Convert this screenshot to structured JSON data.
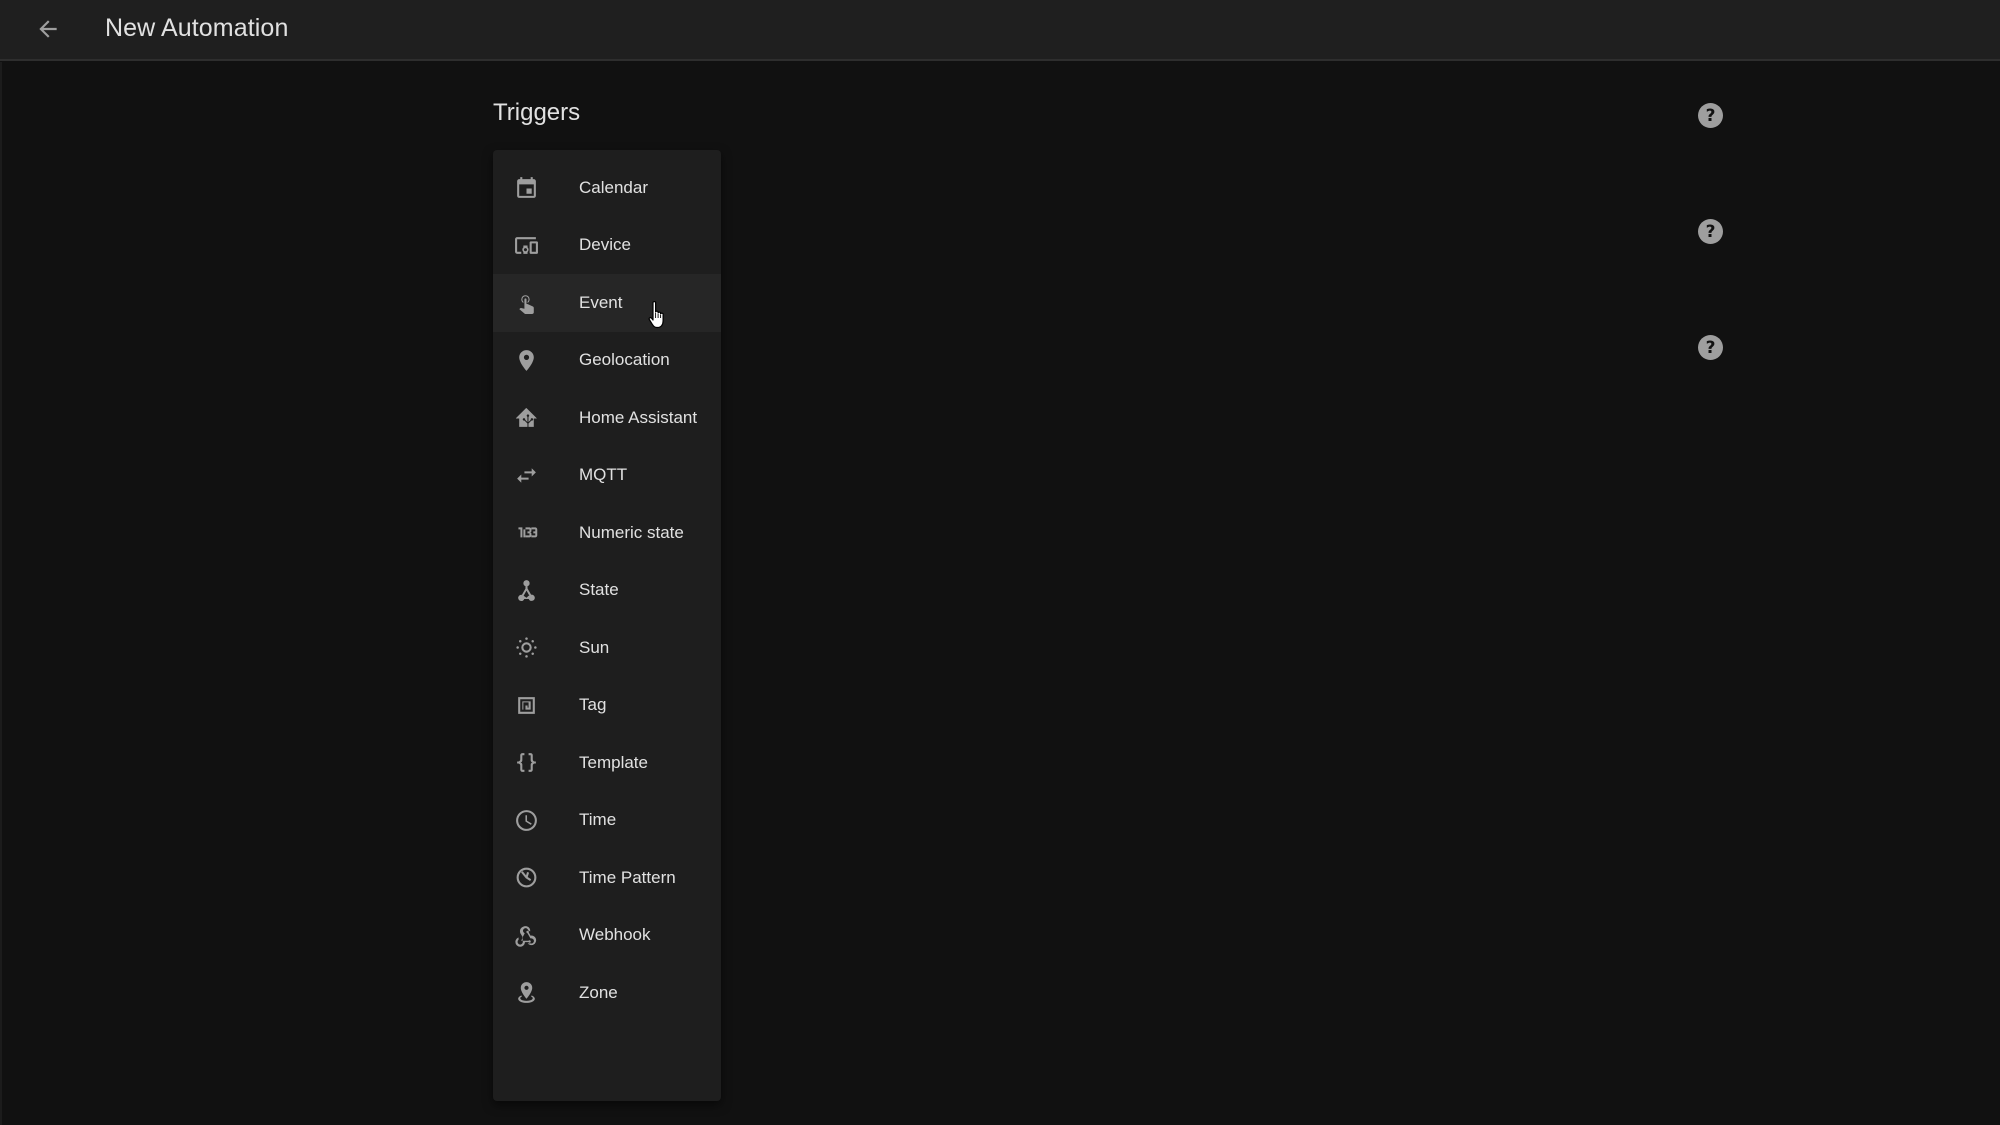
{
  "header": {
    "back_icon": "arrow-left-icon",
    "title": "New Automation"
  },
  "section": {
    "title": "Triggers"
  },
  "help_buttons": [
    {
      "icon": "help-circle-icon",
      "glyph": "?"
    },
    {
      "icon": "help-circle-icon",
      "glyph": "?"
    },
    {
      "icon": "help-circle-icon",
      "glyph": "?"
    }
  ],
  "trigger_menu": {
    "hovered_item": "Event",
    "items": [
      {
        "label": "Calendar",
        "icon": "calendar-icon"
      },
      {
        "label": "Device",
        "icon": "devices-icon"
      },
      {
        "label": "Event",
        "icon": "gesture-tap-icon"
      },
      {
        "label": "Geolocation",
        "icon": "map-marker-icon"
      },
      {
        "label": "Home Assistant",
        "icon": "home-assistant-icon"
      },
      {
        "label": "MQTT",
        "icon": "swap-horizontal-icon"
      },
      {
        "label": "Numeric state",
        "icon": "numeric-icon"
      },
      {
        "label": "State",
        "icon": "state-machine-icon"
      },
      {
        "label": "Sun",
        "icon": "sun-icon"
      },
      {
        "label": "Tag",
        "icon": "nfc-tag-icon"
      },
      {
        "label": "Template",
        "icon": "code-braces-icon"
      },
      {
        "label": "Time",
        "icon": "clock-icon"
      },
      {
        "label": "Time Pattern",
        "icon": "clock-pattern-icon"
      },
      {
        "label": "Webhook",
        "icon": "webhook-icon"
      },
      {
        "label": "Zone",
        "icon": "map-marker-radius-icon"
      }
    ]
  },
  "colors": {
    "background": "#111111",
    "header": "#1f1f1f",
    "card": "#1e1e1e",
    "hover": "#262626",
    "text": "#e1e1e1",
    "icon": "#9e9e9e"
  }
}
